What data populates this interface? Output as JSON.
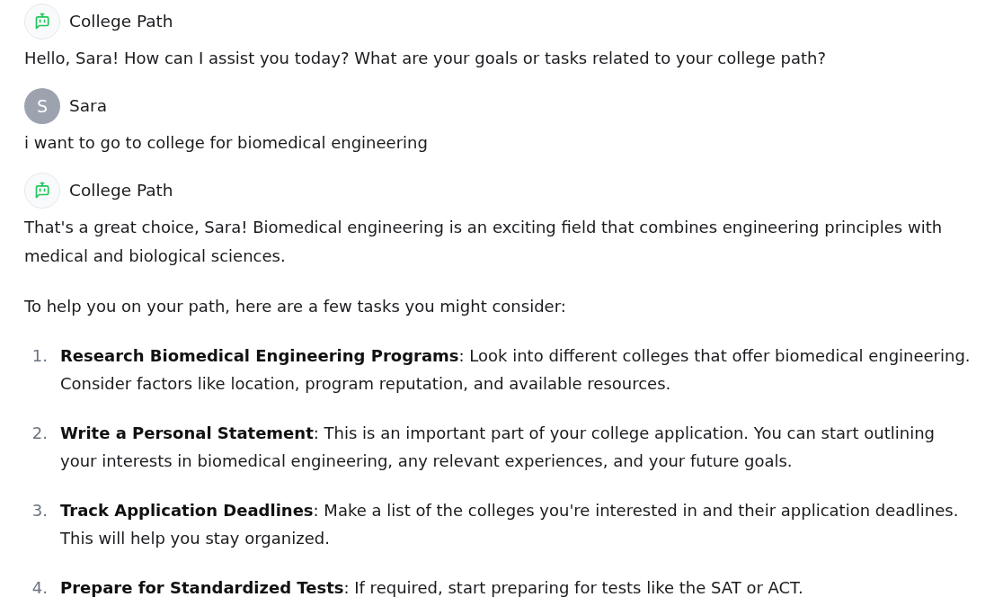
{
  "messages": [
    {
      "kind": "assistant",
      "sender": "College Path",
      "blocks": [
        {
          "kind": "paragraph",
          "text": "Hello, Sara! How can I assist you today? What are your goals or tasks related to your college path?"
        }
      ]
    },
    {
      "kind": "user",
      "sender": "Sara",
      "initial": "S",
      "blocks": [
        {
          "kind": "paragraph",
          "text": "i want to go to college for biomedical engineering"
        }
      ]
    },
    {
      "kind": "assistant",
      "sender": "College Path",
      "blocks": [
        {
          "kind": "paragraph",
          "text": "That's a great choice, Sara! Biomedical engineering is an exciting field that combines engineering principles with medical and biological sciences."
        },
        {
          "kind": "paragraph",
          "text": "To help you on your path, here are a few tasks you might consider:"
        },
        {
          "kind": "list",
          "items": [
            {
              "number": "1.",
              "text": "**Research Biomedical Engineering Programs**: Look into different colleges that offer biomedical engineering. Consider factors like location, program reputation, and available resources."
            },
            {
              "number": "2.",
              "text": "**Write a Personal Statement**: This is an important part of your college application. You can start outlining your interests in biomedical engineering, any relevant experiences, and your future goals."
            },
            {
              "number": "3.",
              "text": "**Track Application Deadlines**: Make a list of the colleges you're interested in and their application deadlines. This will help you stay organized."
            },
            {
              "number": "4.",
              "text": "**Prepare for Standardized Tests**: If required, start preparing for tests like the SAT or ACT."
            }
          ]
        }
      ]
    }
  ]
}
